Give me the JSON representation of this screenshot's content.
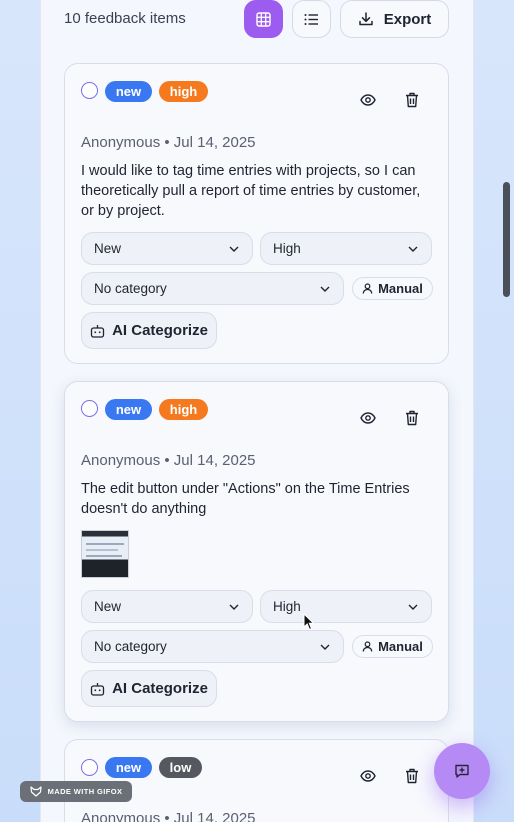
{
  "toolbar": {
    "count_label": "10 feedback items",
    "grid_icon": "grid-icon",
    "list_icon": "list-icon",
    "export_label": "Export",
    "accent": "#9c5cf0"
  },
  "cards": [
    {
      "status_badge": "new",
      "priority_badge": "high",
      "meta": "Anonymous • Jul 14, 2025",
      "text": "I would like to tag time entries with projects, so I can theoretically pull a report of time entries by customer, or by project.",
      "status_value": "New",
      "priority_value": "High",
      "category_value": "No category",
      "source_label": "Manual",
      "ai_label": "AI Categorize"
    },
    {
      "status_badge": "new",
      "priority_badge": "high",
      "meta": "Anonymous • Jul 14, 2025",
      "text": "The edit button under \"Actions\" on the Time Entries doesn't do anything",
      "has_screenshot": true,
      "status_value": "New",
      "priority_value": "High",
      "category_value": "No category",
      "source_label": "Manual",
      "ai_label": "AI Categorize"
    },
    {
      "status_badge": "new",
      "priority_badge": "low",
      "meta": "Anonymous • Jul 14, 2025"
    }
  ],
  "colors": {
    "badge_new": "#3a78f2",
    "badge_high": "#f57a1f",
    "badge_low": "#55585f"
  },
  "watermark": "MADE WITH GIFOX",
  "fab_icon": "feedback-icon"
}
